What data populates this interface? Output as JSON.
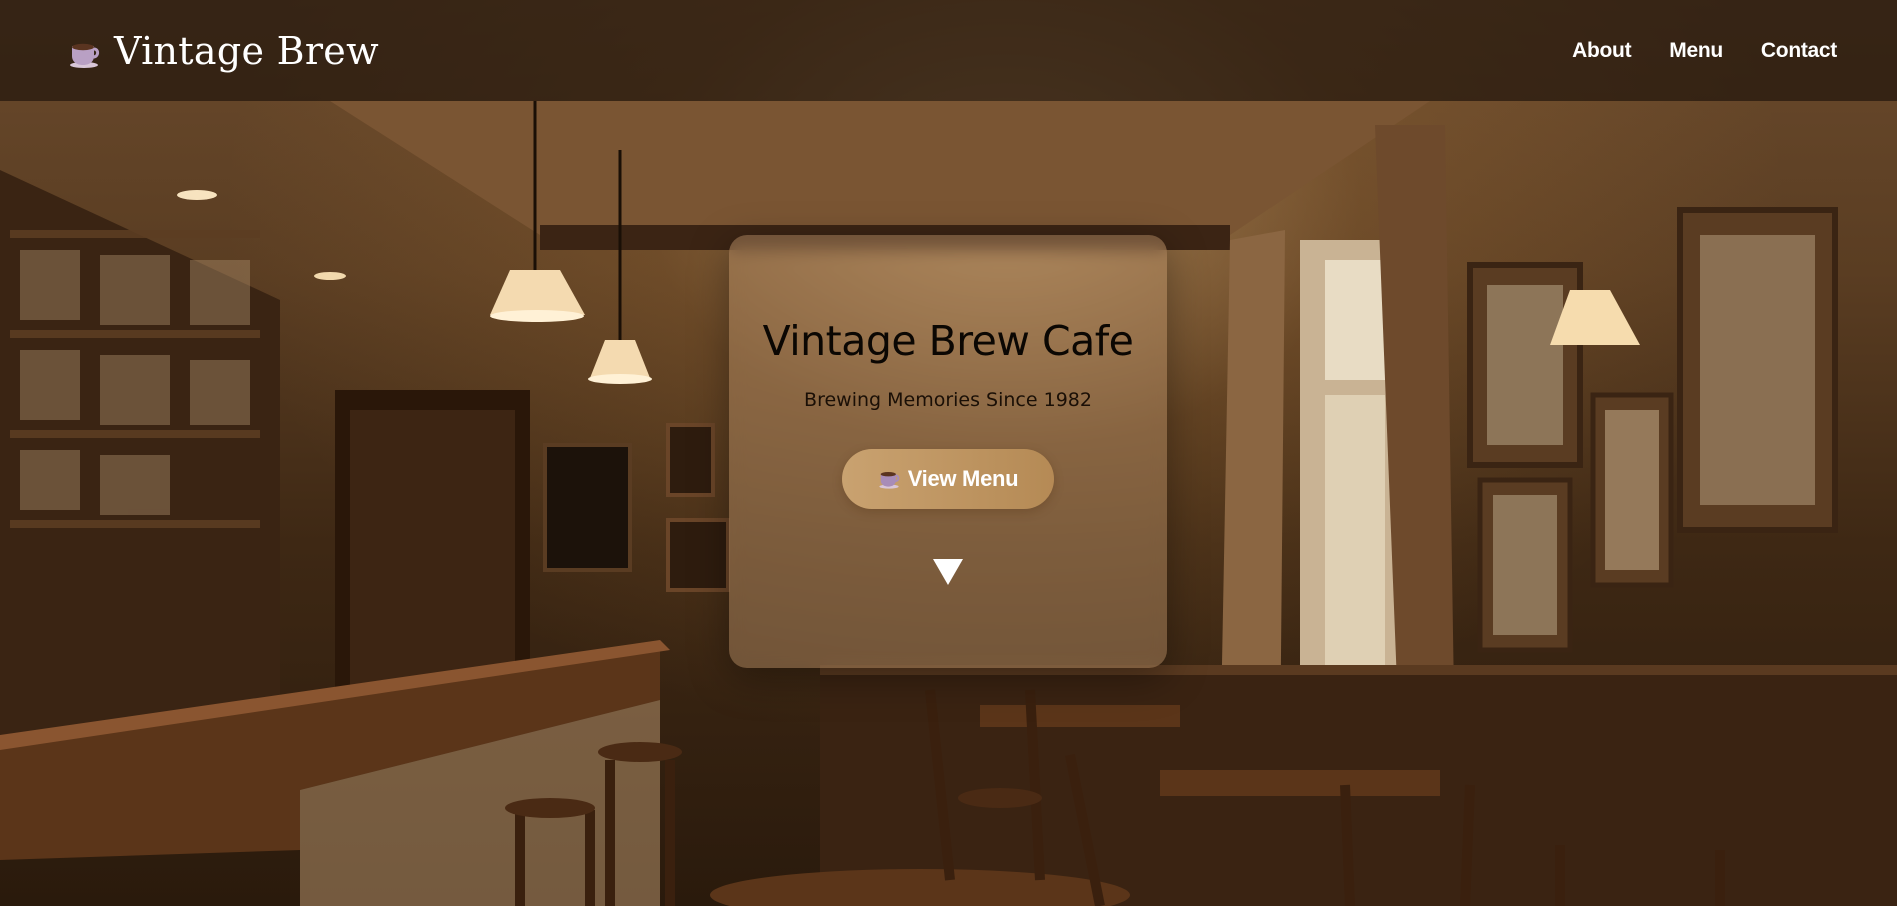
{
  "brand": {
    "name": "Vintage Brew",
    "logo_icon": "coffee-cup-icon"
  },
  "nav": {
    "links": [
      {
        "label": "About"
      },
      {
        "label": "Menu"
      },
      {
        "label": "Contact"
      }
    ]
  },
  "hero": {
    "title": "Vintage Brew Cafe",
    "subtitle": "Brewing Memories Since 1982",
    "cta_label": "View Menu",
    "cta_icon": "coffee-cup-icon",
    "scroll_icon": "down-triangle-icon"
  },
  "colors": {
    "nav_background": "#23160c",
    "card_tint": "#be966e",
    "button_gold": "#c9a270",
    "cup_purple": "#8c6a9e",
    "text_dark": "#0b0703"
  }
}
